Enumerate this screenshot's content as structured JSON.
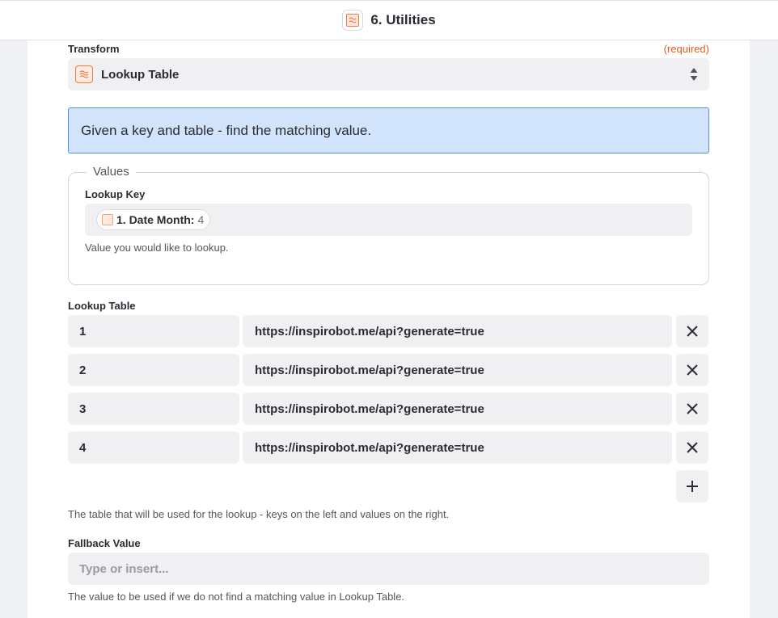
{
  "header": {
    "title": "6. Utilities",
    "icon": "utilities-app-icon"
  },
  "transform": {
    "label": "Transform",
    "required": "(required)",
    "value": "Lookup Table",
    "icon": "formatter-icon"
  },
  "info_banner": "Given a key and table - find the matching value.",
  "values_group": {
    "legend": "Values",
    "lookup_key": {
      "label": "Lookup Key",
      "pill_name": "1. Date Month:",
      "pill_value": "4",
      "help": "Value you would like to lookup."
    }
  },
  "lookup_table": {
    "label": "Lookup Table",
    "rows": [
      {
        "key": "1",
        "value": "https://inspirobot.me/api?generate=true"
      },
      {
        "key": "2",
        "value": "https://inspirobot.me/api?generate=true"
      },
      {
        "key": "3",
        "value": "https://inspirobot.me/api?generate=true"
      },
      {
        "key": "4",
        "value": "https://inspirobot.me/api?generate=true"
      }
    ],
    "help": "The table that will be used for the lookup - keys on the left and values on the right."
  },
  "fallback": {
    "label": "Fallback Value",
    "placeholder": "Type or insert...",
    "help": "The value to be used if we do not find a matching value in Lookup Table."
  },
  "colors": {
    "accent_orange": "#e15e1d",
    "info_bg": "#d2e4fb",
    "info_border": "#4d8ee6",
    "field_bg": "#f0f0f2"
  }
}
